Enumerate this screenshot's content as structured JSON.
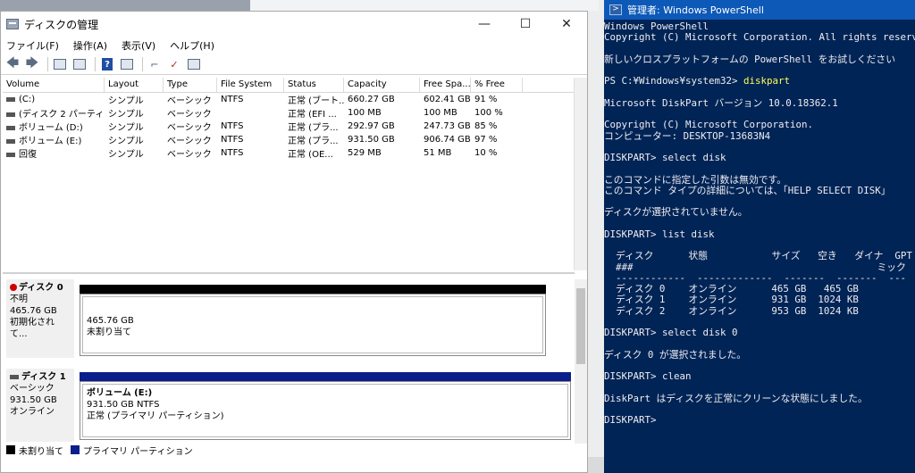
{
  "disk_management": {
    "title": "ディスクの管理",
    "window_buttons": [
      "—",
      "☐",
      "✕"
    ],
    "menu": [
      "ファイル(F)",
      "操作(A)",
      "表示(V)",
      "ヘルプ(H)"
    ],
    "columns": [
      "Volume",
      "Layout",
      "Type",
      "File System",
      "Status",
      "Capacity",
      "Free Spa...",
      "% Free"
    ],
    "volumes": [
      [
        "(C:)",
        "シンプル",
        "ベーシック",
        "NTFS",
        "正常 (ブート...",
        "660.27 GB",
        "602.41 GB",
        "91 %"
      ],
      [
        "(ディスク 2 パーティシ...",
        "シンプル",
        "ベーシック",
        "",
        "正常 (EFI ...",
        "100 MB",
        "100 MB",
        "100 %"
      ],
      [
        "ボリューム (D:)",
        "シンプル",
        "ベーシック",
        "NTFS",
        "正常 (プラ...",
        "292.97 GB",
        "247.73 GB",
        "85 %"
      ],
      [
        "ボリューム (E:)",
        "シンプル",
        "ベーシック",
        "NTFS",
        "正常 (プラ...",
        "931.50 GB",
        "906.74 GB",
        "97 %"
      ],
      [
        "回復",
        "シンプル",
        "ベーシック",
        "NTFS",
        "正常 (OE...",
        "529 MB",
        "51 MB",
        "10 %"
      ]
    ],
    "disk0": {
      "name": "ディスク 0",
      "line1": "不明",
      "line2": "465.76 GB",
      "line3": "初期化されて...",
      "part_size": "465.76 GB",
      "part_status": "未割り当て"
    },
    "disk1": {
      "name": "ディスク 1",
      "line1": "ベーシック",
      "line2": "931.50 GB",
      "line3": "オンライン",
      "part_name": "ボリューム (E:)",
      "part_size": "931.50 GB NTFS",
      "part_status": "正常 (プライマリ パーティション)"
    },
    "legend": [
      "未割り当て",
      "プライマリ パーティション"
    ],
    "colors": {
      "unallocated": "#000000",
      "primary": "#0a1e8c"
    }
  },
  "powershell": {
    "title": "管理者: Windows PowerShell",
    "lines": [
      "Windows PowerShell",
      "Copyright (C) Microsoft Corporation. All rights reserved.",
      "",
      "新しいクロスプラットフォームの PowerShell をお試しください",
      "",
      "PS C:¥Windows¥system32> ",
      "",
      "Microsoft DiskPart バージョン 10.0.18362.1",
      "",
      "Copyright (C) Microsoft Corporation.",
      "コンピューター: DESKTOP-13683N4",
      "",
      "DISKPART> select disk",
      "",
      "このコマンドに指定した引数は無効です。",
      "このコマンド タイプの詳細については、「HELP SELECT DISK」",
      "",
      "ディスクが選択されていません。",
      "",
      "DISKPART> list disk",
      "",
      "  ディスク      状態           サイズ   空き   ダイナ  GPT",
      "  ###                                          ミック",
      "  ------------  -------------  -------  -------  ---  ---",
      "  ディスク 0    オンライン      465 GB   465 GB",
      "  ディスク 1    オンライン      931 GB  1024 KB",
      "  ディスク 2    オンライン      953 GB  1024 KB",
      "",
      "DISKPART> select disk 0",
      "",
      "ディスク 0 が選択されました。",
      "",
      "DISKPART> clean",
      "",
      "DiskPart はディスクを正常にクリーンな状態にしました。",
      "",
      "DISKPART> "
    ],
    "command": "diskpart"
  }
}
